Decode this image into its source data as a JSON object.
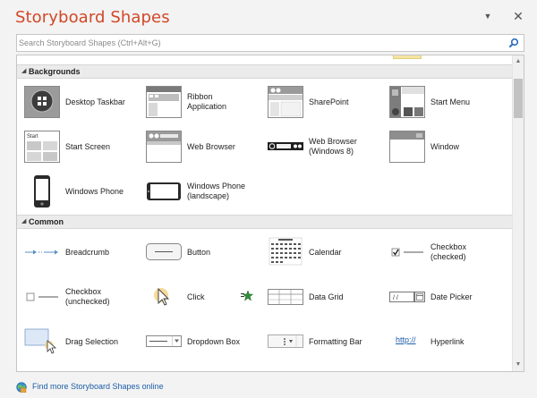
{
  "title": "Storyboard Shapes",
  "search": {
    "placeholder": "Search Storyboard Shapes (Ctrl+Alt+G)"
  },
  "sections": [
    {
      "label": "Backgrounds",
      "items": [
        {
          "label": "Desktop Taskbar",
          "icon": "desktop-taskbar-icon"
        },
        {
          "label": "Ribbon\nApplication",
          "icon": "ribbon-application-icon"
        },
        {
          "label": "SharePoint",
          "icon": "sharepoint-icon"
        },
        {
          "label": "Start Menu",
          "icon": "start-menu-icon"
        },
        {
          "label": "Start Screen",
          "icon": "start-screen-icon",
          "thumb_text": "Start"
        },
        {
          "label": "Web Browser",
          "icon": "web-browser-icon"
        },
        {
          "label": "Web Browser\n(Windows 8)",
          "icon": "web-browser-windows8-icon"
        },
        {
          "label": "Window",
          "icon": "window-icon"
        },
        {
          "label": "Windows Phone",
          "icon": "windows-phone-icon"
        },
        {
          "label": "Windows Phone\n(landscape)",
          "icon": "windows-phone-landscape-icon"
        }
      ]
    },
    {
      "label": "Common",
      "items": [
        {
          "label": "Breadcrumb",
          "icon": "breadcrumb-icon"
        },
        {
          "label": "Button",
          "icon": "button-icon"
        },
        {
          "label": "Calendar",
          "icon": "calendar-icon"
        },
        {
          "label": "Checkbox\n(checked)",
          "icon": "checkbox-checked-icon"
        },
        {
          "label": "Checkbox\n(unchecked)",
          "icon": "checkbox-unchecked-icon"
        },
        {
          "label": "Click",
          "icon": "click-icon"
        },
        {
          "label": "Data Grid",
          "icon": "data-grid-icon"
        },
        {
          "label": "Date Picker",
          "icon": "date-picker-icon"
        },
        {
          "label": "Drag Selection",
          "icon": "drag-selection-icon"
        },
        {
          "label": "Dropdown Box",
          "icon": "dropdown-box-icon"
        },
        {
          "label": "Formatting Bar",
          "icon": "formatting-bar-icon"
        },
        {
          "label": "Hyperlink",
          "icon": "hyperlink-icon",
          "thumb_text": "http://"
        }
      ]
    }
  ],
  "footer": {
    "link": "Find more Storyboard Shapes online"
  },
  "colors": {
    "title": "#d24726",
    "link": "#1d5ea8",
    "header_bg": "#ebebeb"
  }
}
